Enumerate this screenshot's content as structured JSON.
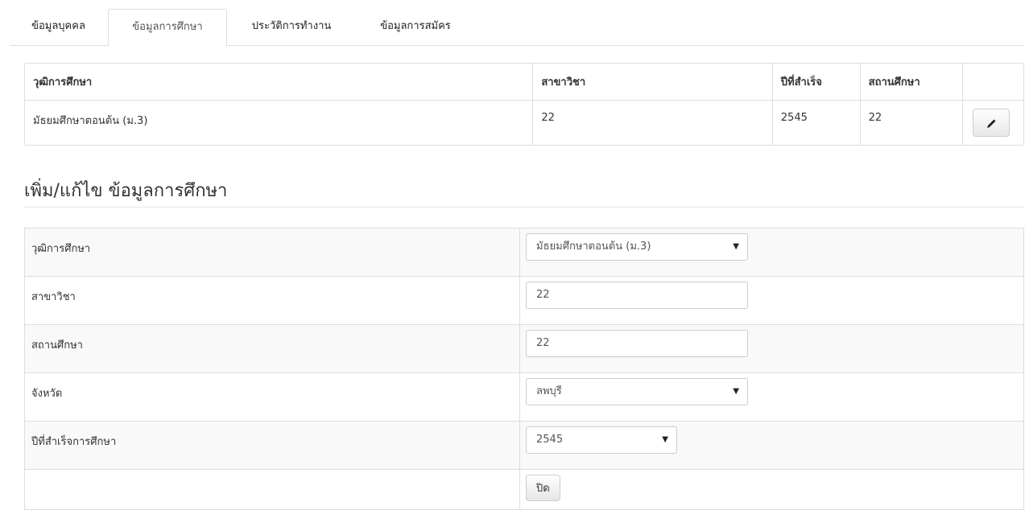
{
  "tabs": [
    {
      "label": "ข้อมูลบุคคล",
      "active": false
    },
    {
      "label": "ข้อมูลการศึกษา",
      "active": true
    },
    {
      "label": "ประวัติการทำงาน",
      "active": false
    },
    {
      "label": "ข้อมูลการสมัคร",
      "active": false
    }
  ],
  "education_table": {
    "headers": [
      "วุฒิการศึกษา",
      "สาขาวิชา",
      "ปีที่สำเร็จ",
      "สถานศึกษา",
      ""
    ],
    "rows": [
      {
        "level": "มัธยมศึกษาตอนต้น (ม.3)",
        "major": "22",
        "year": "2545",
        "school": "22",
        "edit_icon": "pencil-icon"
      }
    ]
  },
  "form": {
    "title": "เพิ่ม/แก้ไข ข้อมูลการศึกษา",
    "fields": [
      {
        "label": "วุฒิการศึกษา",
        "type": "select",
        "value": "มัธยมศึกษาตอนต้น (ม.3)"
      },
      {
        "label": "สาขาวิชา",
        "type": "text",
        "value": "22"
      },
      {
        "label": "สถานศึกษา",
        "type": "text",
        "value": "22"
      },
      {
        "label": "จังหวัด",
        "type": "select",
        "value": "ลพบุรี"
      },
      {
        "label": "ปีที่สำเร็จการศึกษา",
        "type": "select",
        "value": "2545"
      }
    ],
    "close_label": "ปิด"
  },
  "icons": {
    "dropdown_arrow": "▼"
  },
  "colors": {
    "border": "#dddddd",
    "stripe": "#f9f9f9",
    "text": "#333333"
  }
}
